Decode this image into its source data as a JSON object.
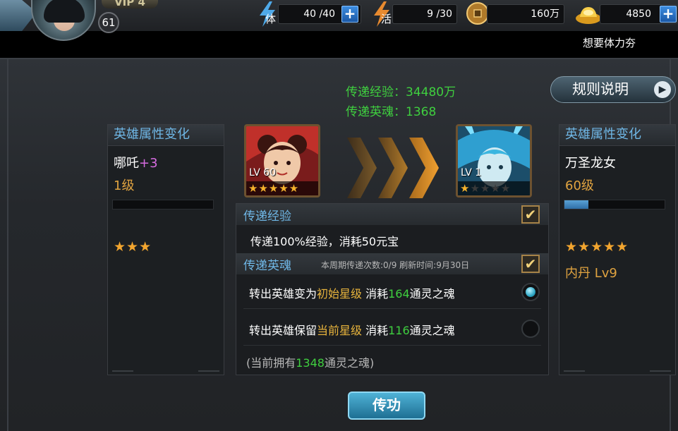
{
  "player": {
    "vip_label": "VIP 4",
    "level": "61"
  },
  "resources": {
    "stamina_label": "体",
    "stamina_value": "40 /40",
    "vigor_label": "活",
    "vigor_value": "9 /30",
    "coins_value": "160万",
    "ingots_value": "4850",
    "plus_symbol": "+",
    "stamina_tip": "想要体力夯"
  },
  "transfer_summary": {
    "exp_text": "传递经验：34480万",
    "soul_text": "传递英魂：1368"
  },
  "rules_button": {
    "label": "规则说明",
    "arrow": "▶"
  },
  "left_hero": {
    "panel_title": "英雄属性变化",
    "name": "哪吒",
    "name_bonus": "+3",
    "level_text": "1级",
    "exp_fraction": 0,
    "stars": "★★★",
    "card_level": "LV 60",
    "card_stars_filled": "★★★★★",
    "card_stars_empty": ""
  },
  "right_hero": {
    "panel_title": "英雄属性变化",
    "name": "万圣龙女",
    "level_text": "60级",
    "exp_fraction": 0.24,
    "stars": "★★★★★",
    "extra_line": "内丹 Lv9",
    "card_level": "LV 1",
    "card_stars_filled": "★",
    "card_stars_empty": "★★★★"
  },
  "options": {
    "exp_section": {
      "title": "传递经验",
      "checked": true,
      "check_glyph": "✔",
      "desc": "传递100%经验，消耗50元宝"
    },
    "soul_section": {
      "title": "传递英魂",
      "checked": true,
      "check_glyph": "✔",
      "period_info": "本周期传递次数:0/9 刷新时间:9月30日"
    },
    "option_initial": {
      "prefix": "转出英雄变为",
      "highlight": "初始星级",
      "mid": " 消耗",
      "cost": "164",
      "suffix": "通灵之魂",
      "selected": true
    },
    "option_keep": {
      "prefix": "转出英雄保留",
      "highlight": "当前星级",
      "mid": " 消耗",
      "cost": "116",
      "suffix": "通灵之魂",
      "selected": false
    },
    "owned": {
      "prefix": "(当前拥有",
      "amount": "1348",
      "suffix": "通灵之魂)"
    }
  },
  "transfer_button": {
    "label": "传功"
  },
  "colors": {
    "accent_blue": "#6fb7e6",
    "highlight_green": "#3fcf3f",
    "highlight_yellow": "#e8b43c",
    "level_orange": "#e0a340"
  }
}
